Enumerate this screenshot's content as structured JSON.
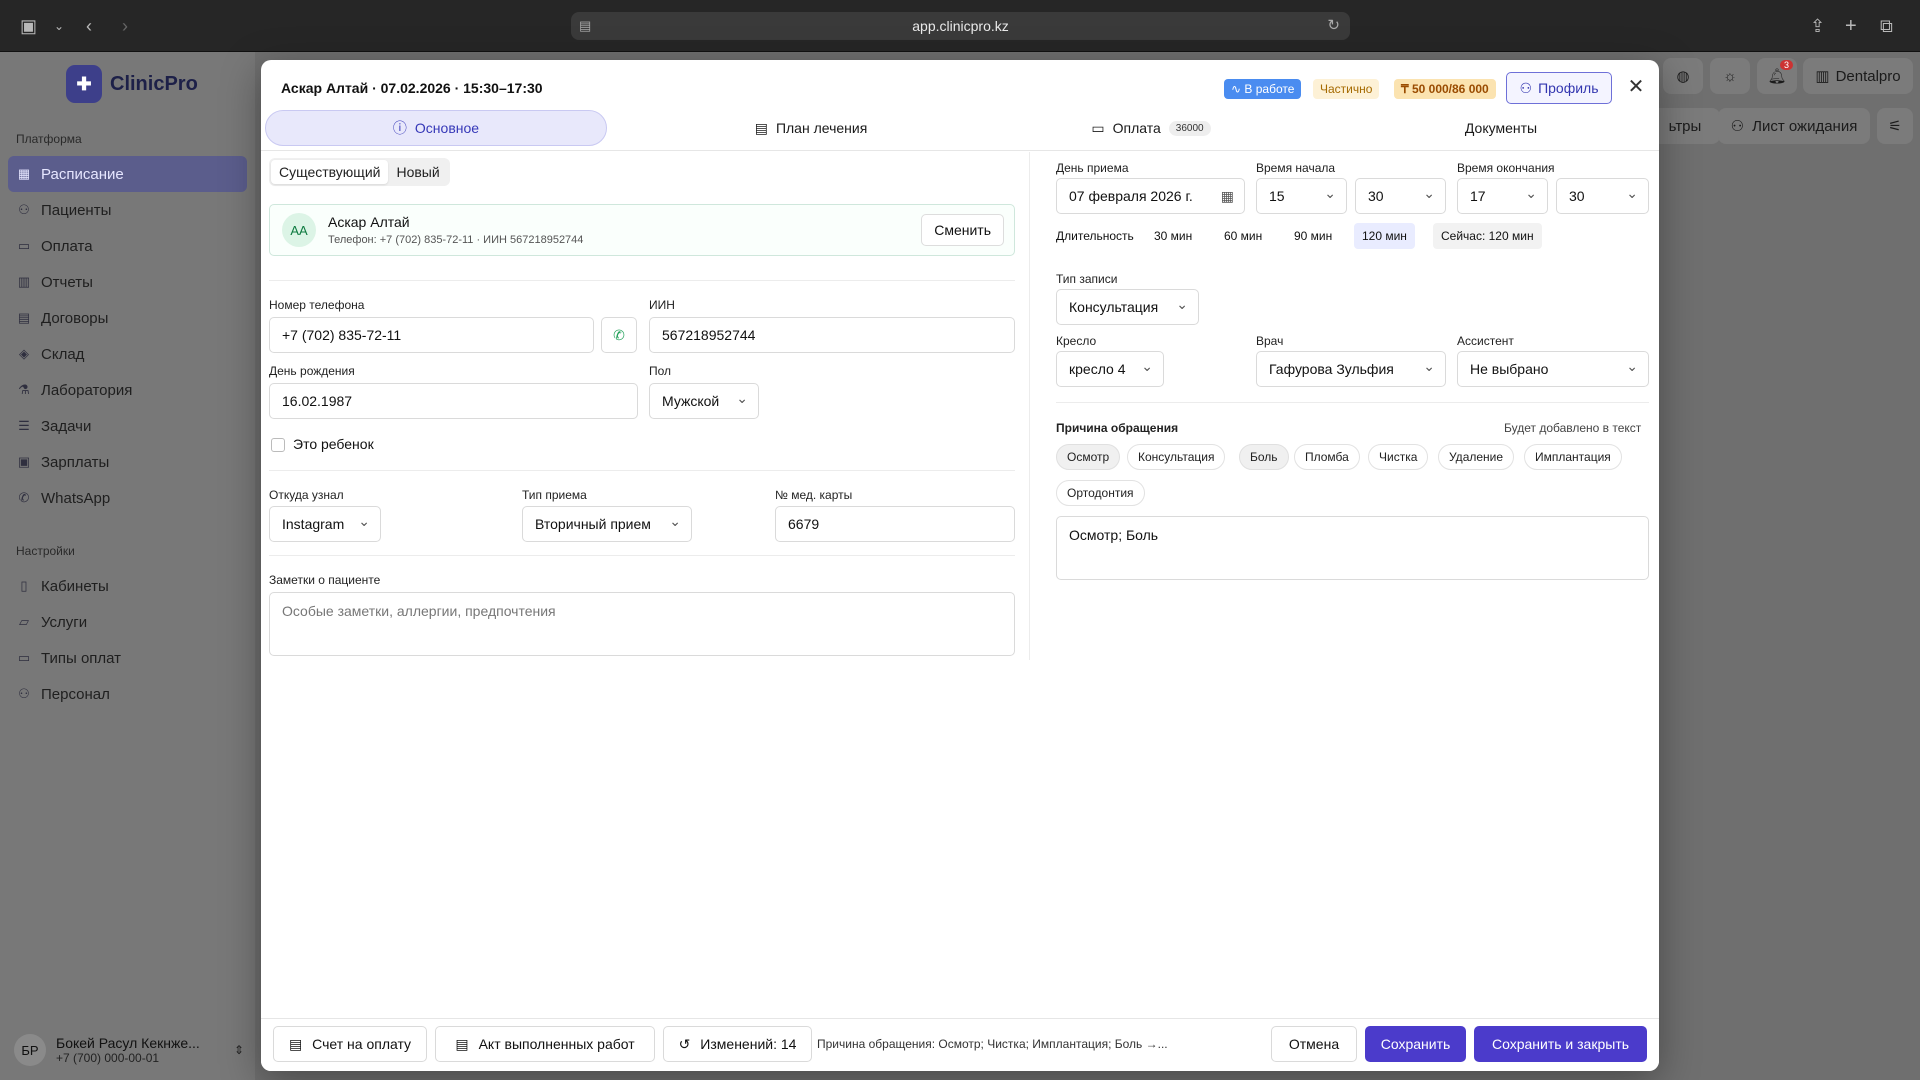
{
  "browser": {
    "url": "app.clinicpro.kz"
  },
  "app": {
    "logo": "ClinicPro"
  },
  "sidebar": {
    "platform_label": "Платформа",
    "items": [
      {
        "label": "Расписание",
        "icon": "calendar-icon"
      },
      {
        "label": "Пациенты",
        "icon": "users-icon"
      },
      {
        "label": "Оплата",
        "icon": "card-icon"
      },
      {
        "label": "Отчеты",
        "icon": "chart-icon"
      },
      {
        "label": "Договоры",
        "icon": "folder-icon"
      },
      {
        "label": "Склад",
        "icon": "box-icon"
      },
      {
        "label": "Лаборатория",
        "icon": "flask-icon"
      },
      {
        "label": "Задачи",
        "icon": "list-icon"
      },
      {
        "label": "Зарплаты",
        "icon": "money-icon"
      },
      {
        "label": "WhatsApp",
        "icon": "whatsapp-icon"
      }
    ],
    "settings_label": "Настройки",
    "settings_items": [
      {
        "label": "Кабинеты",
        "icon": "door-icon"
      },
      {
        "label": "Услуги",
        "icon": "service-icon"
      },
      {
        "label": "Типы оплат",
        "icon": "card-icon"
      },
      {
        "label": "Персонал",
        "icon": "staff-icon"
      }
    ],
    "user": {
      "initials": "БР",
      "name": "Бокей Расул Кекнже...",
      "phone": "+7 (700) 000-00-01"
    }
  },
  "header": {
    "notification_count": "3",
    "clinic_name": "Dentalpro",
    "filters_label": "ьтры",
    "waitlist_label": "Лист ожидания"
  },
  "modal": {
    "title": "Аскар Алтай · 07.02.2026 · 15:30–17:30",
    "badges": {
      "status": "В работе",
      "payment_status": "Частично",
      "amount": "₸ 50 000/86 000"
    },
    "profile_button": "Профиль",
    "tabs": [
      {
        "label": "Основное"
      },
      {
        "label": "План лечения"
      },
      {
        "label": "Оплата",
        "count": "36000"
      },
      {
        "label": "Документы"
      }
    ],
    "left": {
      "segment": {
        "existing": "Существующий",
        "new": "Новый"
      },
      "patient": {
        "initials": "АА",
        "name": "Аскар Алтай",
        "info": "Телефон: +7 (702) 835-72-11 · ИИН 567218952744",
        "change_button": "Сменить"
      },
      "phone_label": "Номер телефона",
      "phone_value": "+7 (702) 835-72-11",
      "iin_label": "ИИН",
      "iin_value": "567218952744",
      "birthday_label": "День рождения",
      "birthday_value": "16.02.1987",
      "gender_label": "Пол",
      "gender_value": "Мужской",
      "child_label": "Это ребенок",
      "source_label": "Откуда узнал",
      "source_value": "Instagram",
      "visit_type_label": "Тип приема",
      "visit_type_value": "Вторичный прием",
      "card_label": "№ мед. карты",
      "card_value": "6679",
      "notes_label": "Заметки о пациенте",
      "notes_placeholder": "Особые заметки, аллергии, предпочтения"
    },
    "right": {
      "day_label": "День приема",
      "day_value": "07 февраля 2026 г.",
      "start_label": "Время начала",
      "start_hour": "15",
      "start_min": "30",
      "end_label": "Время окончания",
      "end_hour": "17",
      "end_min": "30",
      "duration_label": "Длительность",
      "durations": [
        "30 мин",
        "60 мин",
        "90 мин",
        "120 мин"
      ],
      "duration_now": "Сейчас: 120 мин",
      "record_type_label": "Тип записи",
      "record_type_value": "Консультация",
      "chair_label": "Кресло",
      "chair_value": "кресло 4",
      "doctor_label": "Врач",
      "doctor_value": "Гафурова Зульфия",
      "assistant_label": "Ассистент",
      "assistant_value": "Не выбрано",
      "reason_label": "Причина обращения",
      "reason_hint": "Будет добавлено в текст",
      "reasons": [
        "Осмотр",
        "Консультация",
        "Боль",
        "Пломба",
        "Чистка",
        "Удаление",
        "Имплантация",
        "Ортодонтия"
      ],
      "reason_text": "Осмотр; Боль"
    },
    "footer": {
      "invoice": "Счет на оплату",
      "act": "Акт выполненных работ",
      "changes": "Изменений: 14",
      "note": "Причина обращения: Осмотр; Чистка; Имплантация; Боль →...",
      "cancel": "Отмена",
      "save": "Сохранить",
      "save_close": "Сохранить и закрыть"
    }
  }
}
